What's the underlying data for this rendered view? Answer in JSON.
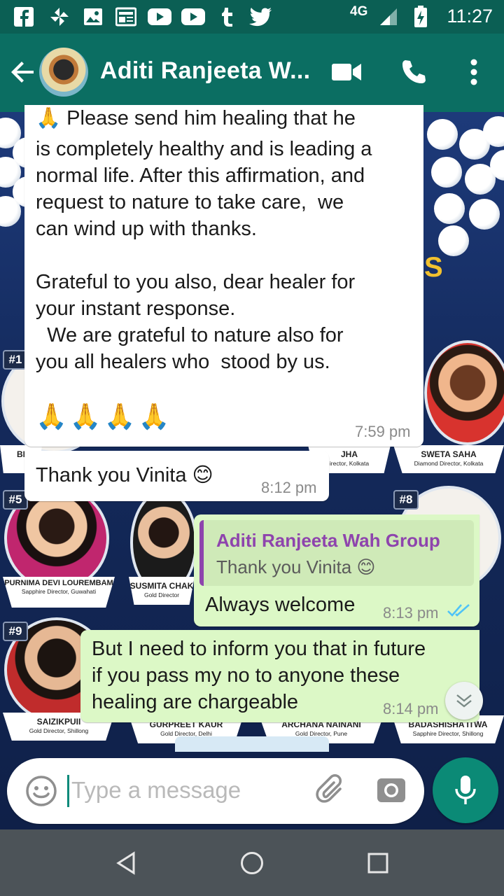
{
  "status_bar": {
    "network": "4G",
    "time": "11:27",
    "app_icons": [
      "facebook-icon",
      "pinwheel-icon",
      "gallery-icon",
      "news-icon",
      "youtube-icon",
      "youtube-icon",
      "tumblr-icon",
      "twitter-icon"
    ]
  },
  "toolbar": {
    "title": "Aditi Ranjeeta W..."
  },
  "wallpaper": {
    "cards": [
      {
        "rank": "#1",
        "name": "",
        "role": ""
      },
      {
        "rank": "#5",
        "name": "PURNIMA DEVI LOUREMBAM",
        "role": "Sapphire Director, Guwahati"
      },
      {
        "rank": "#8",
        "name": "",
        "role": ""
      },
      {
        "rank": "#9",
        "name": "SAIZIKPUII",
        "role": "Gold Director, Shillong"
      }
    ],
    "plates": [
      {
        "name": "SWETA SAHA",
        "role": "Diamond Director, Kolkata"
      },
      {
        "name": "SUSMITA CHAK",
        "role": "Gold Director"
      },
      {
        "name": "GURPREET KAUR",
        "role": "Gold Director, Delhi"
      },
      {
        "name": "ARCHANA NAINANI",
        "role": "Gold Director, Pune"
      },
      {
        "name": "BADASHISHA ITWA",
        "role": "Sapphire Director, Shillong"
      },
      {
        "name": "JHA",
        "role": "irector, Kolkata"
      }
    ],
    "badge_letter": "S"
  },
  "messages": [
    {
      "direction": "incoming",
      "text_top": "🙏 Please send him healing that he",
      "text": "is completely healthy and is leading a\nnormal life. After this affirmation, and\nrequest to nature to take care,  we\ncan wind up with thanks.\n\nGrateful to you also, dear healer for\nyour instant response.\n  We are grateful to nature also for\nyou all healers who  stood by us.",
      "emoji": "🙏🙏🙏🙏",
      "time": "7:59 pm"
    },
    {
      "direction": "incoming",
      "text": "Thank you Vinita 😊",
      "time": "8:12 pm"
    },
    {
      "direction": "outgoing",
      "quote_name": "Aditi Ranjeeta Wah Group",
      "quote_text": "Thank you Vinita 😊",
      "text": "Always welcome",
      "time": "8:13 pm",
      "status": "read"
    },
    {
      "direction": "outgoing",
      "text": "But I need to inform you that in future\nif you pass my no to anyone these\nhealing are chargeable",
      "time": "8:14 pm"
    }
  ],
  "composer": {
    "placeholder": "Type a message"
  },
  "colors": {
    "header": "#0b6e62",
    "status_bar": "#0b5f54",
    "outgoing_bubble": "#dcf8c6",
    "incoming_bubble": "#ffffff",
    "accent": "#0b8a76",
    "quote_author": "#8e44ad",
    "read_ticks": "#4fc3f7"
  }
}
